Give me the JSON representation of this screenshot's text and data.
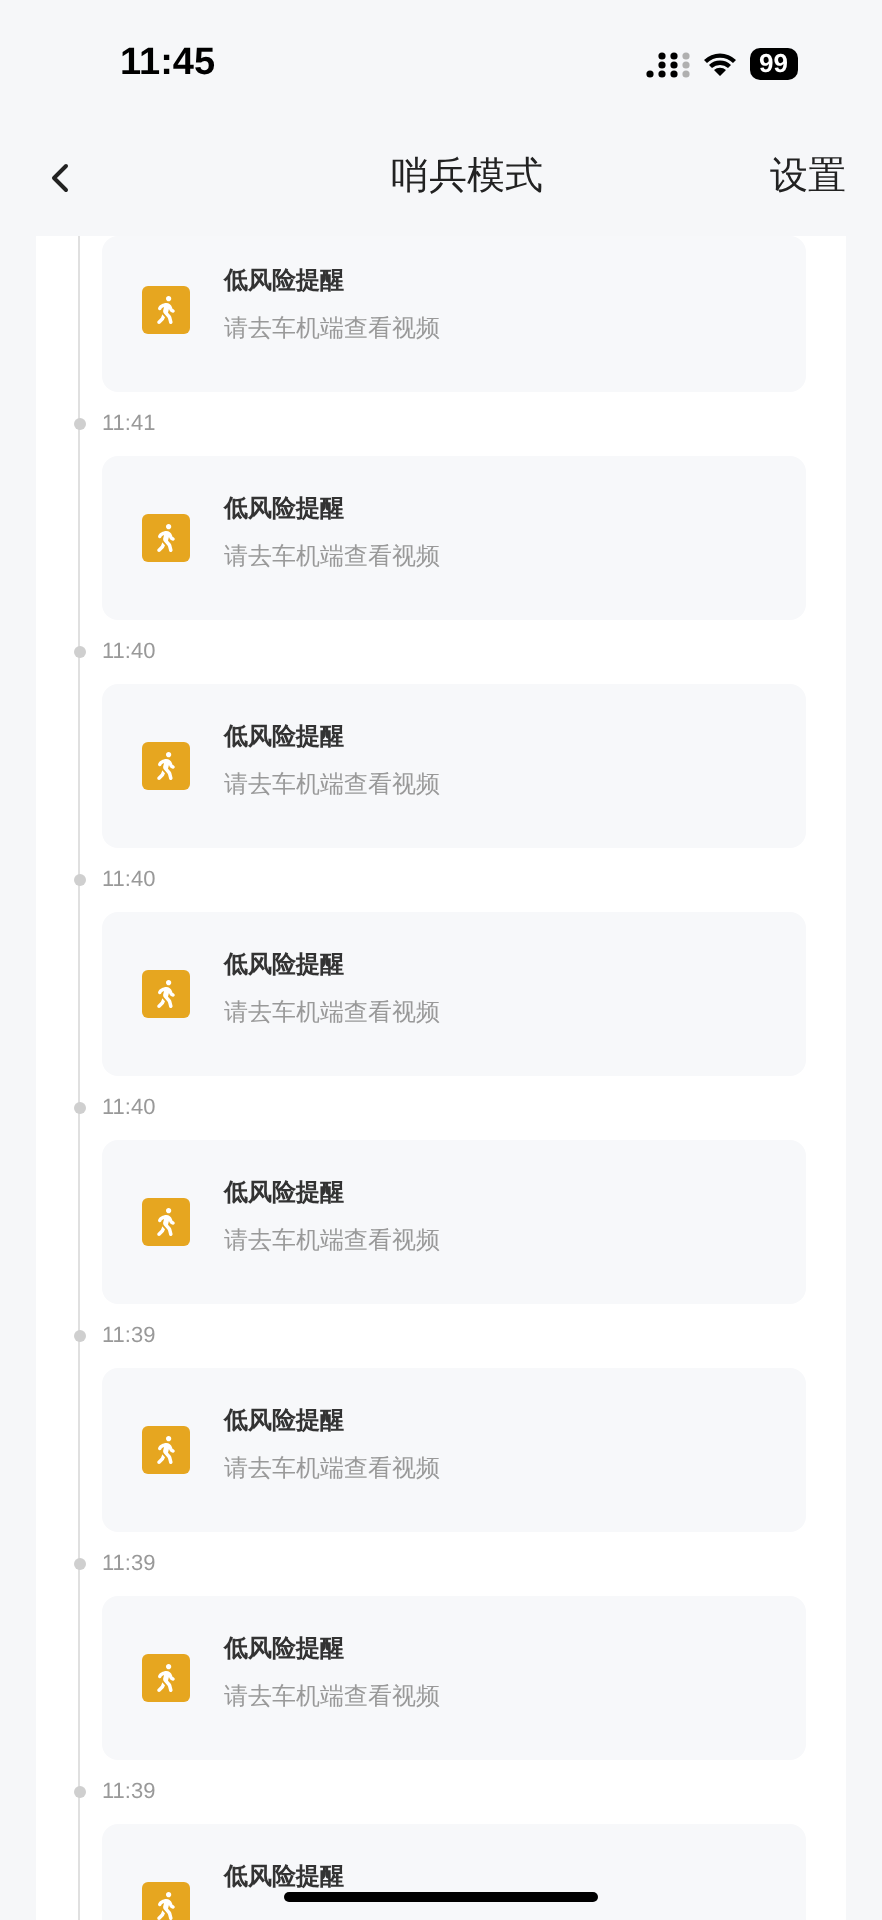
{
  "status_bar": {
    "time": "11:45",
    "battery": "99"
  },
  "nav": {
    "title": "哨兵模式",
    "action": "设置"
  },
  "events": [
    {
      "title": "低风险提醒",
      "subtitle": "请去车机端查看视频"
    },
    {
      "time": "11:41",
      "title": "低风险提醒",
      "subtitle": "请去车机端查看视频"
    },
    {
      "time": "11:40",
      "title": "低风险提醒",
      "subtitle": "请去车机端查看视频"
    },
    {
      "time": "11:40",
      "title": "低风险提醒",
      "subtitle": "请去车机端查看视频"
    },
    {
      "time": "11:40",
      "title": "低风险提醒",
      "subtitle": "请去车机端查看视频"
    },
    {
      "time": "11:39",
      "title": "低风险提醒",
      "subtitle": "请去车机端查看视频"
    },
    {
      "time": "11:39",
      "title": "低风险提醒",
      "subtitle": "请去车机端查看视频"
    },
    {
      "time": "11:39",
      "title": "低风险提醒"
    }
  ]
}
